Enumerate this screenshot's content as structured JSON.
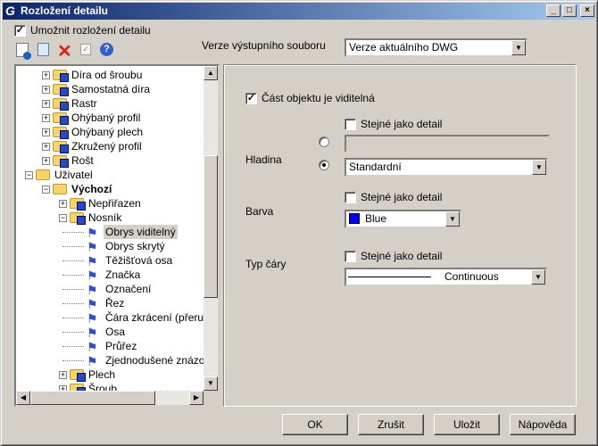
{
  "window": {
    "title": "Rozložení detailu",
    "controls": [
      "_",
      "□",
      "×"
    ]
  },
  "enable_checkbox": {
    "label": "Umožnit rozložení detailu",
    "checked": true
  },
  "toolbar": {
    "icons": [
      "new-icon",
      "copy-icon",
      "delete-icon",
      "check-icon",
      "help-icon"
    ]
  },
  "output_version": {
    "label": "Verze výstupního souboru",
    "value": "Verze aktuálního DWG"
  },
  "tree": {
    "items": [
      {
        "label": "Díra od šroubu",
        "level": 2,
        "expander": "+",
        "icon": "folder-config"
      },
      {
        "label": "Samostatná díra",
        "level": 2,
        "expander": "+",
        "icon": "folder-config"
      },
      {
        "label": "Rastr",
        "level": 2,
        "expander": "+",
        "icon": "folder-config"
      },
      {
        "label": "Ohýbaný profil",
        "level": 2,
        "expander": "+",
        "icon": "folder-config"
      },
      {
        "label": "Ohýbaný plech",
        "level": 2,
        "expander": "+",
        "icon": "folder-config"
      },
      {
        "label": "Zkružený profil",
        "level": 2,
        "expander": "+",
        "icon": "folder-config"
      },
      {
        "label": "Rošt",
        "level": 2,
        "expander": "+",
        "icon": "folder-config"
      },
      {
        "label": "Uživatel",
        "level": 1,
        "expander": "−",
        "icon": "folder"
      },
      {
        "label": "Výchozí",
        "level": 2,
        "expander": "−",
        "icon": "folder",
        "bold": true
      },
      {
        "label": "Nepřiřazen",
        "level": 3,
        "expander": "+",
        "icon": "folder-config"
      },
      {
        "label": "Nosník",
        "level": 3,
        "expander": "−",
        "icon": "folder-config"
      },
      {
        "label": "Obrys viditelný",
        "level": 4,
        "icon": "flag",
        "selected": true
      },
      {
        "label": "Obrys skrytý",
        "level": 4,
        "icon": "flag"
      },
      {
        "label": "Těžišťová osa",
        "level": 4,
        "icon": "flag"
      },
      {
        "label": "Značka",
        "level": 4,
        "icon": "flag"
      },
      {
        "label": "Označení",
        "level": 4,
        "icon": "flag"
      },
      {
        "label": "Řez",
        "level": 4,
        "icon": "flag"
      },
      {
        "label": "Čára zkrácení (přeruše",
        "level": 4,
        "icon": "flag"
      },
      {
        "label": "Osa",
        "level": 4,
        "icon": "flag"
      },
      {
        "label": "Průřez",
        "level": 4,
        "icon": "flag"
      },
      {
        "label": "Zjednodušené znázorn",
        "level": 4,
        "icon": "flag"
      },
      {
        "label": "Plech",
        "level": 3,
        "expander": "+",
        "icon": "folder-config"
      },
      {
        "label": "Šroub",
        "level": 3,
        "expander": "+",
        "icon": "folder-config"
      }
    ]
  },
  "props": {
    "visible": {
      "label": "Část objektu je viditelná",
      "checked": true
    },
    "layer": {
      "label": "Hladina",
      "same_label": "Stejné jako detail",
      "same_checked": false,
      "text_value": "",
      "selected_radio": 2,
      "value": "Standardní"
    },
    "color": {
      "label": "Barva",
      "same_label": "Stejné jako detail",
      "same_checked": false,
      "value": "Blue",
      "swatch": "#0000ff"
    },
    "linetype": {
      "label": "Typ čáry",
      "same_label": "Stejné jako detail",
      "same_checked": false,
      "value": "Continuous"
    }
  },
  "buttons": {
    "ok": "OK",
    "cancel": "Zrušit",
    "save": "Uložit",
    "help": "Nápověda"
  }
}
